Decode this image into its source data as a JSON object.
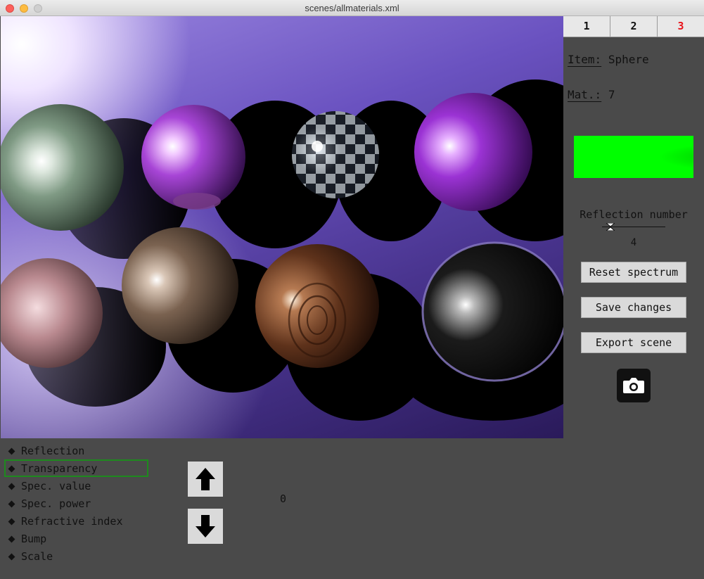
{
  "window": {
    "title": "scenes/allmaterials.xml"
  },
  "tabs": [
    {
      "label": "1",
      "active": false
    },
    {
      "label": "2",
      "active": false
    },
    {
      "label": "3",
      "active": true
    }
  ],
  "inspector": {
    "item_key": "Item:",
    "item_value": "Sphere",
    "mat_key": "Mat.:",
    "mat_value": "7",
    "spectrum_color": "#00ff00"
  },
  "reflection": {
    "label": "Reflection number",
    "value": "4"
  },
  "buttons": {
    "reset": "Reset spectrum",
    "save": "Save changes",
    "export": "Export scene"
  },
  "properties": [
    {
      "label": "Reflection",
      "selected": false
    },
    {
      "label": "Transparency",
      "selected": true
    },
    {
      "label": "Spec. value",
      "selected": false
    },
    {
      "label": "Spec. power",
      "selected": false
    },
    {
      "label": "Refractive index",
      "selected": false
    },
    {
      "label": "Bump",
      "selected": false
    },
    {
      "label": "Scale",
      "selected": false
    }
  ],
  "property_value": "0",
  "colors": {
    "accent_tab": "#e8141b",
    "selection_border": "#1e8a1e"
  }
}
